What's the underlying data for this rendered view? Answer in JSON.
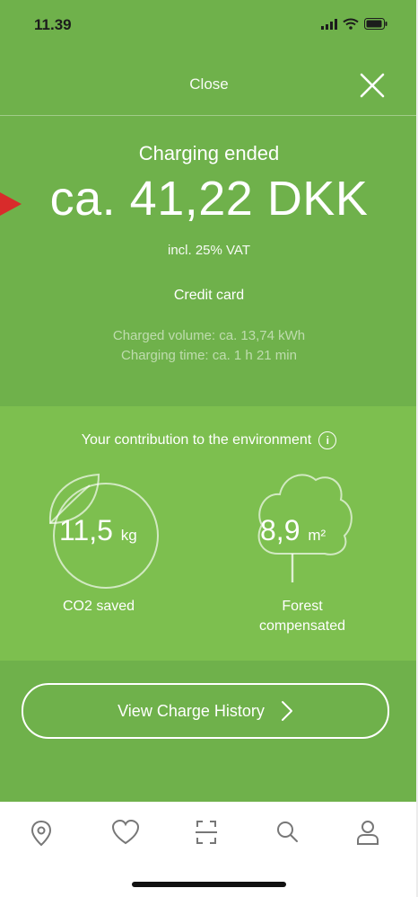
{
  "status_bar": {
    "time": "11.39"
  },
  "header": {
    "close_label": "Close"
  },
  "summary": {
    "title": "Charging ended",
    "amount": "ca. 41,22 DKK",
    "vat_note": "incl. 25% VAT",
    "payment_method": "Credit card",
    "charged_volume": "Charged volume: ca. 13,74 kWh",
    "charging_time": "Charging time: ca. 1 h 21 min"
  },
  "environment": {
    "title": "Your contribution to the environment",
    "co2": {
      "value": "11,5",
      "unit": "kg",
      "label": "CO2 saved"
    },
    "forest": {
      "value": "8,9",
      "unit": "m²",
      "label_line1": "Forest",
      "label_line2": "compensated"
    }
  },
  "actions": {
    "history_button": "View Charge History"
  },
  "tabbar": {
    "items": [
      "location-pin-icon",
      "heart-icon",
      "scan-icon",
      "search-icon",
      "profile-icon"
    ]
  },
  "colors": {
    "primary_green": "#6fb14b",
    "light_green": "#7dbf4f",
    "accent_red": "#d82b2b"
  }
}
